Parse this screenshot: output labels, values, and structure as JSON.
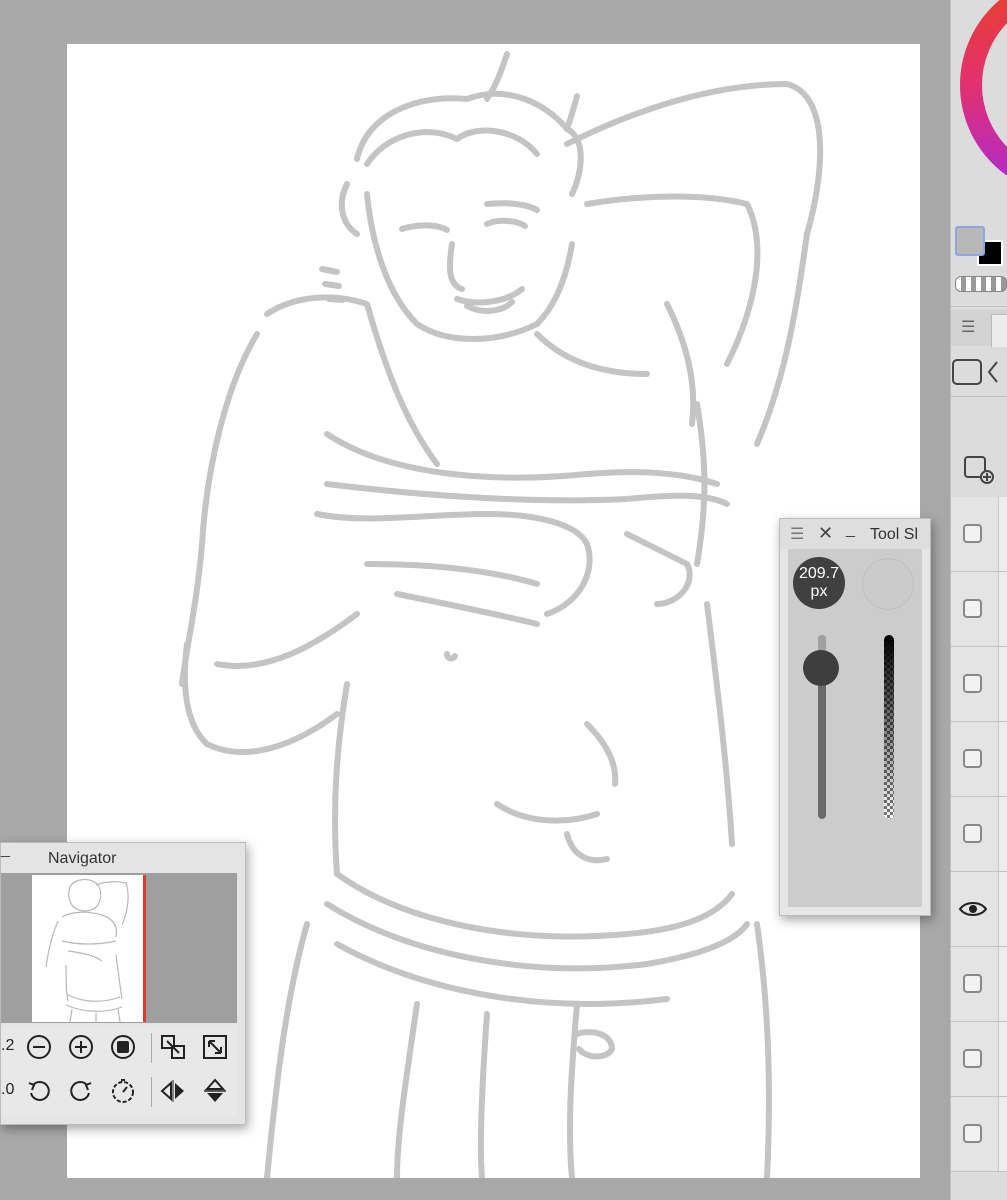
{
  "tool_property": {
    "title": "Tool Sl",
    "brush_size_value": "209.7",
    "brush_size_unit": "px",
    "brush_size_level": 0.82,
    "opacity_level": 1.0,
    "current_color": "#cbcbcb"
  },
  "navigator": {
    "title": "Navigator",
    "zoom_value": ".2",
    "rotation_value": ".0",
    "frame_color": "#e03a2b"
  },
  "colors": {
    "main_color": "#b8b8b8",
    "sub_color": "#000000",
    "canvas_bg": "#a8a8a8",
    "paper": "#ffffff",
    "sketch_stroke": "#c4c4c4"
  },
  "layers": [
    {
      "visible": false,
      "icon": "checkbox-icon"
    },
    {
      "visible": false,
      "icon": "checkbox-icon"
    },
    {
      "visible": false,
      "icon": "checkbox-icon"
    },
    {
      "visible": false,
      "icon": "checkbox-icon"
    },
    {
      "visible": false,
      "icon": "checkbox-icon"
    },
    {
      "visible": true,
      "icon": "eye-icon"
    },
    {
      "visible": false,
      "icon": "checkbox-icon"
    },
    {
      "visible": false,
      "icon": "checkbox-icon"
    },
    {
      "visible": false,
      "icon": "checkbox-icon"
    }
  ]
}
